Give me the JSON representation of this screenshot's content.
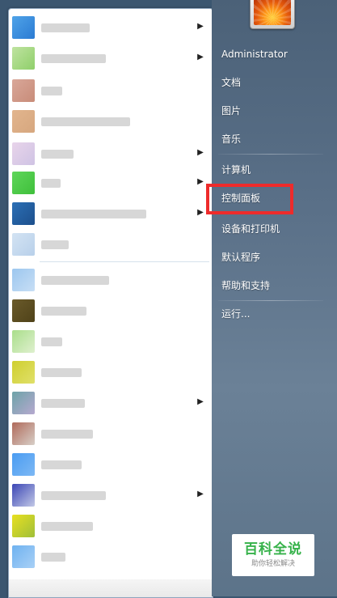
{
  "user": {
    "name": "Administrator",
    "avatar_icon": "flower-avatar-icon"
  },
  "right_menu": {
    "documents": "文档",
    "pictures": "图片",
    "music": "音乐",
    "computer": "计算机",
    "control_panel": "控制面板",
    "devices_printers": "设备和打印机",
    "default_programs": "默认程序",
    "help_support": "帮助和支持",
    "run": "运行..."
  },
  "highlight_color": "#ee2b2b",
  "watermark": {
    "title": "百科全说",
    "subtitle": "助你轻松解决"
  }
}
